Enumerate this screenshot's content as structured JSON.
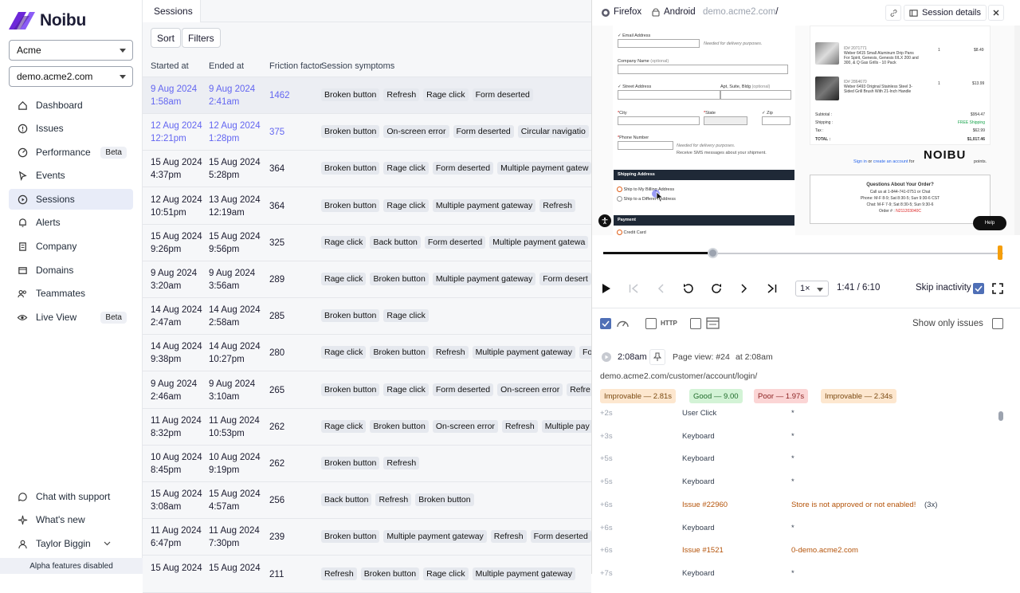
{
  "app": {
    "name": "Noibu",
    "org_select": "Acme",
    "domain_select": "demo.acme2.com"
  },
  "nav": [
    {
      "label": "Dashboard",
      "icon": "home-icon"
    },
    {
      "label": "Issues",
      "icon": "alert-circle-icon"
    },
    {
      "label": "Performance",
      "icon": "gauge-icon",
      "badge": "Beta"
    },
    {
      "label": "Events",
      "icon": "cursor-icon"
    },
    {
      "label": "Sessions",
      "icon": "play-circle-icon"
    },
    {
      "label": "Alerts",
      "icon": "bell-icon"
    },
    {
      "label": "Company",
      "icon": "building-icon"
    },
    {
      "label": "Domains",
      "icon": "window-icon"
    },
    {
      "label": "Teammates",
      "icon": "users-icon"
    },
    {
      "label": "Live View",
      "icon": "eye-icon",
      "badge": "Beta"
    }
  ],
  "footer_nav": [
    {
      "label": "Chat with support",
      "icon": "chat-icon"
    },
    {
      "label": "What's new",
      "icon": "sparkle-icon"
    },
    {
      "label": "Taylor Biggin",
      "icon": "user-icon"
    }
  ],
  "alpha_label": "Alpha features disabled",
  "main": {
    "tab": "Sessions",
    "sort_label": "Sort",
    "filters_label": "Filters",
    "columns": [
      "Started at",
      "Ended at",
      "Friction factor",
      "Session symptoms"
    ],
    "rows": [
      {
        "start_date": "9 Aug 2024",
        "start_time": "1:58am",
        "end_date": "9 Aug 2024",
        "end_time": "2:41am",
        "friction": "1462",
        "symptoms": [
          "Broken button",
          "Refresh",
          "Rage click",
          "Form deserted"
        ]
      },
      {
        "start_date": "12 Aug 2024",
        "start_time": "12:21pm",
        "end_date": "12 Aug 2024",
        "end_time": "1:28pm",
        "friction": "375",
        "symptoms": [
          "Broken button",
          "On-screen error",
          "Form deserted",
          "Circular navigatio"
        ]
      },
      {
        "start_date": "15 Aug 2024",
        "start_time": "4:37pm",
        "end_date": "15 Aug 2024",
        "end_time": "5:28pm",
        "friction": "364",
        "symptoms": [
          "Broken button",
          "Rage click",
          "Form deserted",
          "Multiple payment gatew"
        ]
      },
      {
        "start_date": "12 Aug 2024",
        "start_time": "10:51pm",
        "end_date": "13 Aug 2024",
        "end_time": "12:19am",
        "friction": "364",
        "symptoms": [
          "Broken button",
          "Rage click",
          "Multiple payment gateway",
          "Refresh"
        ]
      },
      {
        "start_date": "15 Aug 2024",
        "start_time": "9:26pm",
        "end_date": "15 Aug 2024",
        "end_time": "9:56pm",
        "friction": "325",
        "symptoms": [
          "Rage click",
          "Back button",
          "Form deserted",
          "Multiple payment gatewa"
        ]
      },
      {
        "start_date": "9 Aug 2024",
        "start_time": "3:20am",
        "end_date": "9 Aug 2024",
        "end_time": "3:56am",
        "friction": "289",
        "symptoms": [
          "Rage click",
          "Broken button",
          "Multiple payment gateway",
          "Form desert"
        ]
      },
      {
        "start_date": "14 Aug 2024",
        "start_time": "2:47am",
        "end_date": "14 Aug 2024",
        "end_time": "2:58am",
        "friction": "285",
        "symptoms": [
          "Broken button",
          "Rage click"
        ]
      },
      {
        "start_date": "14 Aug 2024",
        "start_time": "9:38pm",
        "end_date": "14 Aug 2024",
        "end_time": "10:27pm",
        "friction": "280",
        "symptoms": [
          "Rage click",
          "Broken button",
          "Refresh",
          "Multiple payment gateway",
          "Fo"
        ]
      },
      {
        "start_date": "9 Aug 2024",
        "start_time": "2:46am",
        "end_date": "9 Aug 2024",
        "end_time": "3:10am",
        "friction": "265",
        "symptoms": [
          "Broken button",
          "Rage click",
          "Form deserted",
          "On-screen error",
          "Refre"
        ]
      },
      {
        "start_date": "11 Aug 2024",
        "start_time": "8:32pm",
        "end_date": "11 Aug 2024",
        "end_time": "10:53pm",
        "friction": "262",
        "symptoms": [
          "Rage click",
          "Broken button",
          "On-screen error",
          "Refresh",
          "Multiple pay"
        ]
      },
      {
        "start_date": "10 Aug 2024",
        "start_time": "8:45pm",
        "end_date": "10 Aug 2024",
        "end_time": "9:19pm",
        "friction": "262",
        "symptoms": [
          "Broken button",
          "Refresh"
        ]
      },
      {
        "start_date": "15 Aug 2024",
        "start_time": "3:08am",
        "end_date": "15 Aug 2024",
        "end_time": "4:57am",
        "friction": "256",
        "symptoms": [
          "Back button",
          "Refresh",
          "Broken button"
        ]
      },
      {
        "start_date": "11 Aug 2024",
        "start_time": "6:47pm",
        "end_date": "11 Aug 2024",
        "end_time": "7:30pm",
        "friction": "239",
        "symptoms": [
          "Broken button",
          "Multiple payment gateway",
          "Refresh",
          "Form deserted"
        ]
      },
      {
        "start_date": "15 Aug 2024",
        "start_time": "",
        "end_date": "15 Aug 2024",
        "end_time": "",
        "friction": "211",
        "symptoms": [
          "Refresh",
          "Broken button",
          "Rage click",
          "Multiple payment gateway"
        ]
      }
    ]
  },
  "panel": {
    "browser": "Firefox",
    "os": "Android",
    "url_host": "demo.acme2.com",
    "url_path": "/",
    "details_label": "Session details",
    "replay": {
      "email_label": "Email Address",
      "delivery_note": "Needed for delivery purposes.",
      "company_label": "Company Name",
      "optional": "(optional)",
      "street_label": "Street Address",
      "apt_label": "Apt, Suite, Bldg",
      "city_label": "City",
      "state_label": "State",
      "zip_label": "Zip",
      "phone_label": "Phone Number",
      "sms_label": "Receive SMS messages about your shipment.",
      "shipping_header": "Shipping Address",
      "ship_opt1": "Ship to My Billing Address",
      "ship_opt2": "Ship to a Different Address",
      "payment_header": "Payment",
      "credit_card": "Credit Card",
      "item1_id": "ID# 2071771",
      "item1_name": "Weber 6415 Small Aluminum Drip Pans For Spirit, Genesis, Genesis II/LX 200 and 300, & Q Gas Grills - 10 Pack",
      "item1_qty": "1",
      "item1_price": "$8.49",
      "item2_id": "ID# 2864670",
      "item2_name": "Weber 6493 Original Stainless Steel 3-Sided Grill Brush With 21-Inch Handle",
      "item2_qty": "1",
      "item2_price": "$13.99",
      "subtotal_label": "Subtotal :",
      "subtotal": "$954.47",
      "shipping_label": "Shipping :",
      "shipping": "FREE Shipping",
      "tax_label": "Tax :",
      "tax": "$62.99",
      "total_label": "TOTAL :",
      "total": "$1,017.46",
      "signin_pre": "Sign in",
      "signin_mid": "or",
      "signin_link": "create an account",
      "signin_for": "for",
      "points": "points.",
      "brand": "NOIBU",
      "q_title": "Questions About Your Order?",
      "q_line1": "Call us at 1-844-741-0751 or Chat",
      "q_line2": "Phone: M-F 8-9; Sat 8:30-5; Sun 9:30-6 CST",
      "q_line3": "Chat: M-F 7-9; Sat 8:30-5; Sun 9:30-6",
      "q_order_label": "Order # :",
      "q_order": "N211203040C",
      "help": "Help"
    },
    "progress_fraction": 0.2738,
    "speed": "1×",
    "time": "1:41 / 6:10",
    "skip_label": "Skip inactivity",
    "http_label": "HTTP",
    "only_issues_label": "Show only issues",
    "page_view": {
      "time": "2:08am",
      "label": "Page view: #24",
      "at": "at 2:08am",
      "url": "demo.acme2.com/customer/account/login/"
    },
    "metrics": [
      {
        "label": "Improvable — 2.81s",
        "bg": "#fde7cf",
        "fg": "#7a4a12"
      },
      {
        "label": "Good — 9.00",
        "bg": "#d3f3d6",
        "fg": "#1f6b2a"
      },
      {
        "label": "Poor — 1.97s",
        "bg": "#fbd5d5",
        "fg": "#8a1f1f"
      },
      {
        "label": "Improvable — 2.34s",
        "bg": "#fde7cf",
        "fg": "#7a4a12"
      }
    ],
    "events": [
      {
        "t": "+2s",
        "name": "User Click",
        "detail": "*"
      },
      {
        "t": "+3s",
        "name": "Keyboard",
        "detail": "*"
      },
      {
        "t": "+5s",
        "name": "Keyboard",
        "detail": "*"
      },
      {
        "t": "+5s",
        "name": "Keyboard",
        "detail": "*"
      },
      {
        "t": "+6s",
        "name": "Issue #22960",
        "detail": "Store is not approved or not enabled!",
        "count": "(3x)",
        "issue": true
      },
      {
        "t": "+6s",
        "name": "Keyboard",
        "detail": "*"
      },
      {
        "t": "+6s",
        "name": "Issue #1521",
        "detail": "0-demo.acme2.com",
        "issue": true
      },
      {
        "t": "+7s",
        "name": "Keyboard",
        "detail": "*"
      }
    ]
  },
  "colors": {
    "accent": "#6366f1",
    "issue": "#b45309",
    "brand": "#6d28d9"
  }
}
